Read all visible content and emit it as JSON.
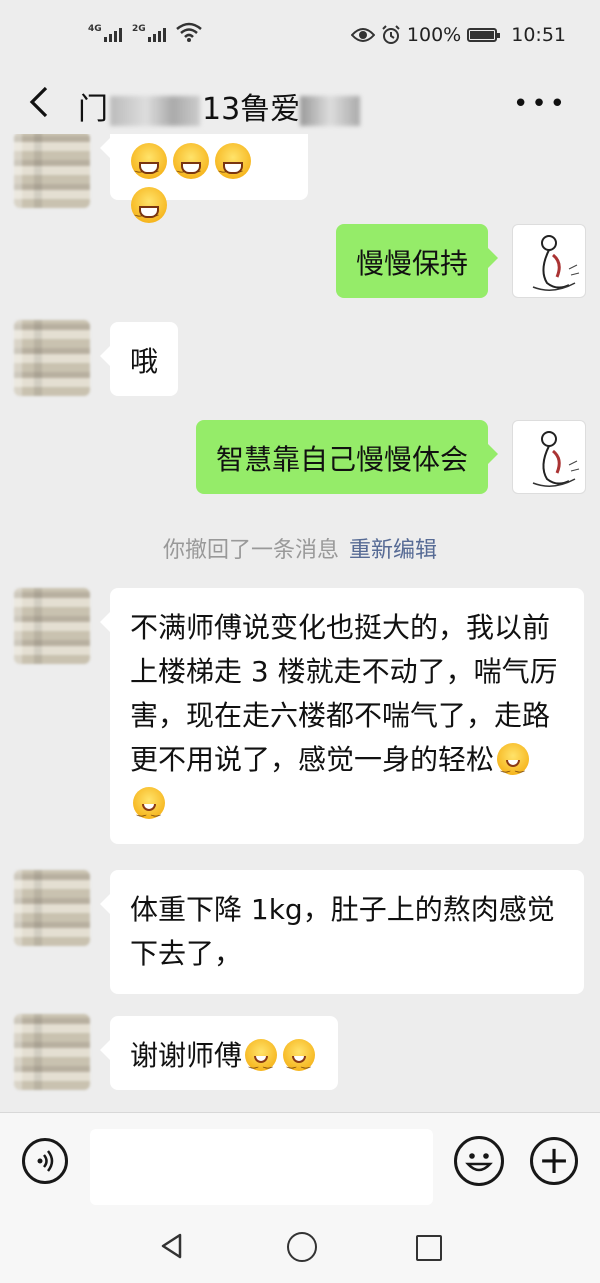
{
  "status_bar": {
    "signal_1": "4G",
    "signal_2": "2G",
    "battery": "100%",
    "time": "10:51"
  },
  "header": {
    "title_start": "门",
    "title_mid": "13鲁爱",
    "more_icon": "more-dots-icon"
  },
  "messages": [
    {
      "side": "left",
      "text": ""
    },
    {
      "side": "right",
      "text": "慢慢保持"
    },
    {
      "side": "left",
      "text": "哦"
    },
    {
      "side": "right",
      "text": "智慧靠自己慢慢体会"
    },
    {
      "side": "left",
      "text": "不满师傅说变化也挺大的，我以前上楼梯走 3 楼就走不动了，喘气厉害，现在走六楼都不喘气了，走路更不用说了，感觉一身的轻松"
    },
    {
      "side": "left",
      "text": "体重下降 1kg，肚子上的熬肉感觉下去了，"
    },
    {
      "side": "left",
      "text": "谢谢师傅"
    }
  ],
  "system": {
    "recall_text": "你撤回了一条消息",
    "reedit_link": "重新编辑"
  },
  "input": {
    "placeholder": ""
  }
}
